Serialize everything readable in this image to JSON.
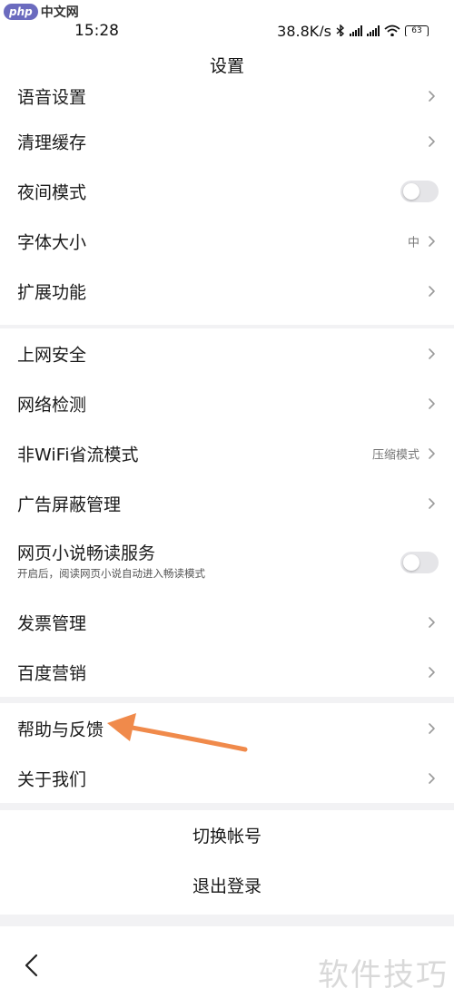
{
  "watermark": {
    "logo_text": "php",
    "site": "中文网",
    "corner": "软件技巧"
  },
  "status_bar": {
    "time": "15:28",
    "network_speed": "38.8K/s",
    "battery": "63"
  },
  "header": {
    "title": "设置"
  },
  "group1": [
    {
      "label": "语音设置",
      "control": "chevron"
    },
    {
      "label": "清理缓存",
      "control": "chevron"
    },
    {
      "label": "夜间模式",
      "control": "toggle",
      "on": false
    },
    {
      "label": "字体大小",
      "control": "chevron",
      "value": "中"
    },
    {
      "label": "扩展功能",
      "control": "chevron"
    }
  ],
  "group2": [
    {
      "label": "上网安全",
      "control": "chevron"
    },
    {
      "label": "网络检测",
      "control": "chevron"
    },
    {
      "label": "非WiFi省流模式",
      "control": "chevron",
      "value": "压缩模式"
    },
    {
      "label": "广告屏蔽管理",
      "control": "chevron"
    },
    {
      "label": "网页小说畅读服务",
      "subtitle": "开启后，阅读网页小说自动进入畅读模式",
      "control": "toggle",
      "on": false
    },
    {
      "label": "发票管理",
      "control": "chevron"
    },
    {
      "label": "百度营销",
      "control": "chevron"
    }
  ],
  "group3": [
    {
      "label": "帮助与反馈",
      "control": "chevron"
    },
    {
      "label": "关于我们",
      "control": "chevron"
    }
  ],
  "actions": {
    "switch_account": "切换帐号",
    "logout": "退出登录"
  },
  "colors": {
    "annotation_arrow": "#f08a4b",
    "page_bg": "#f2f2f4",
    "toggle_off": "#e5e5e8"
  }
}
